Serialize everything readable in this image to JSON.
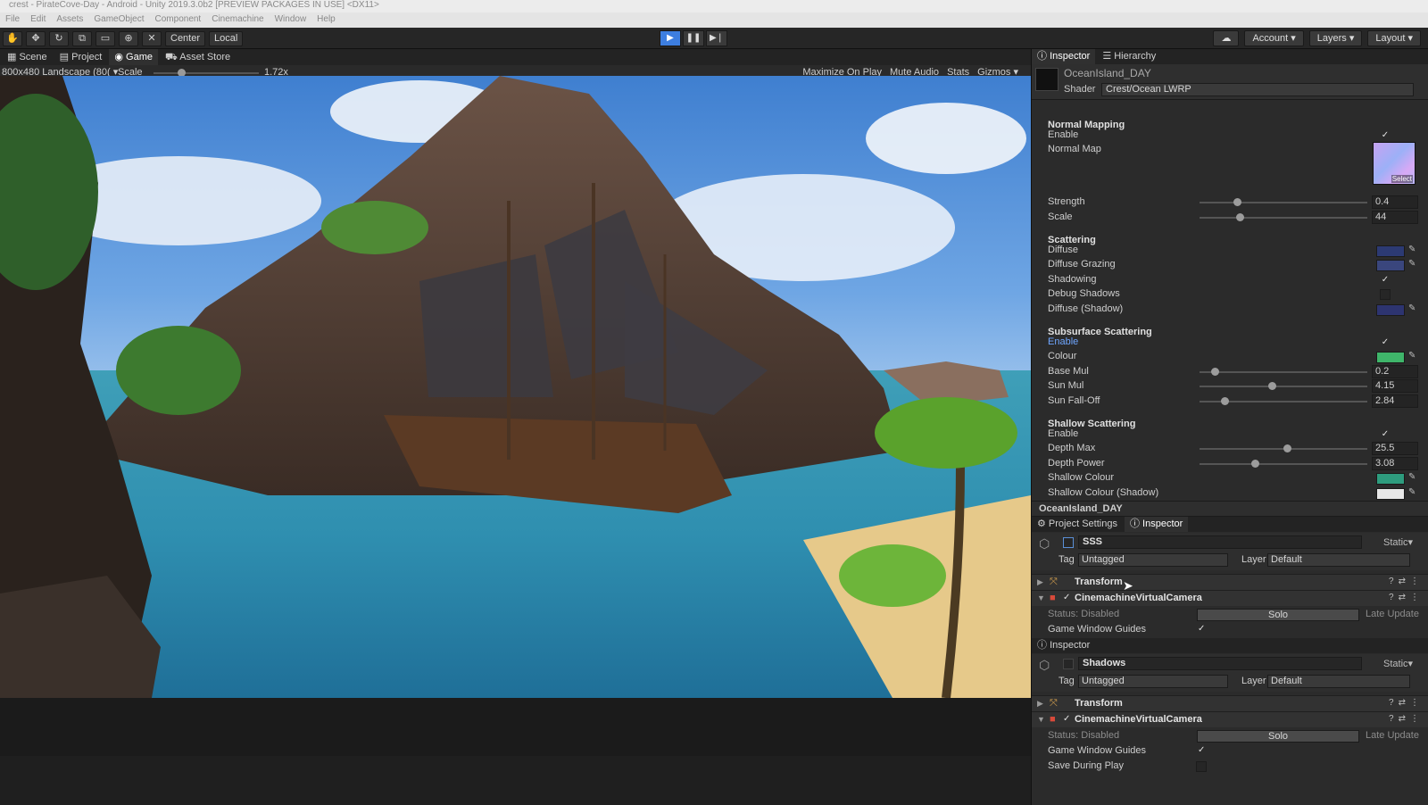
{
  "window": {
    "title": "crest - PirateCove-Day - Android - Unity 2019.3.0b2 [PREVIEW PACKAGES IN USE] <DX11>"
  },
  "menu": [
    "File",
    "Edit",
    "Assets",
    "GameObject",
    "Component",
    "Cinemachine",
    "Window",
    "Help"
  ],
  "toolbar": {
    "pivot_center": "Center",
    "pivot_local": "Local",
    "account": "Account",
    "layers": "Layers",
    "layout": "Layout"
  },
  "scene_tabs": [
    "Scene",
    "Project",
    "Game",
    "Asset Store"
  ],
  "game_bar": {
    "resolution": "800x480 Landscape (80(",
    "scale_label": "Scale",
    "scale_value": "1.72x",
    "scale_fraction": 0.23,
    "options": [
      "Maximize On Play",
      "Mute Audio",
      "Stats",
      "Gizmos"
    ]
  },
  "inspector": {
    "tabs": [
      "Inspector",
      "Hierarchy"
    ],
    "material_name": "OceanIsland_DAY",
    "shader_label": "Shader",
    "shader_value": "Crest/Ocean LWRP",
    "normal_mapping": {
      "title": "Normal Mapping",
      "enable": "Enable",
      "normal_map": "Normal Map",
      "select": "Select",
      "strength_label": "Strength",
      "strength": "0.4",
      "strength_fraction": 0.2,
      "scale_label": "Scale",
      "scale": "44",
      "scale_fraction": 0.22
    },
    "scattering": {
      "title": "Scattering",
      "diffuse": "Diffuse",
      "diffuse_grazing": "Diffuse Grazing",
      "shadowing": "Shadowing",
      "debug_shadows": "Debug Shadows",
      "diffuse_shadow": "Diffuse (Shadow)",
      "diffuse_color": "#2c3a73",
      "diffuse_grazing_color": "#3a467d",
      "diffuse_shadow_color": "#2d3470"
    },
    "subsurface": {
      "title": "Subsurface Scattering",
      "enable": "Enable",
      "colour": "Colour",
      "colour_value": "#3fb56a",
      "base_mul_label": "Base Mul",
      "base_mul": "0.2",
      "base_mul_fraction": 0.07,
      "sun_mul_label": "Sun Mul",
      "sun_mul": "4.15",
      "sun_mul_fraction": 0.41,
      "sun_falloff_label": "Sun Fall-Off",
      "sun_falloff": "2.84",
      "sun_falloff_fraction": 0.13
    },
    "shallow": {
      "title": "Shallow Scattering",
      "enable": "Enable",
      "depth_max_label": "Depth Max",
      "depth_max": "25.5",
      "depth_max_fraction": 0.5,
      "depth_power_label": "Depth Power",
      "depth_power": "3.08",
      "depth_power_fraction": 0.31,
      "shallow_colour": "Shallow Colour",
      "shallow_colour_value": "#2e9c7e",
      "shallow_colour_shadow": "Shallow Colour (Shadow)",
      "shallow_colour_shadow_value": "#e7e7e7"
    },
    "footer_name": "OceanIsland_DAY"
  },
  "panel2": {
    "tabs": [
      "Project Settings",
      "Inspector"
    ],
    "object_name": "SSS",
    "static": "Static",
    "tag_label": "Tag",
    "tag": "Untagged",
    "layer_label": "Layer",
    "layer": "Default",
    "transform": "Transform",
    "cm_camera": "CinemachineVirtualCamera",
    "status": "Status: Disabled",
    "solo": "Solo",
    "late_update": "Late Update",
    "game_window_guides": "Game Window Guides"
  },
  "panel3": {
    "tab": "Inspector",
    "object_name": "Shadows",
    "static": "Static",
    "tag_label": "Tag",
    "tag": "Untagged",
    "layer_label": "Layer",
    "layer": "Default",
    "transform": "Transform",
    "cm_camera": "CinemachineVirtualCamera",
    "status": "Status: Disabled",
    "solo": "Solo",
    "late_update": "Late Update",
    "game_window_guides": "Game Window Guides",
    "save_during_play": "Save During Play"
  }
}
